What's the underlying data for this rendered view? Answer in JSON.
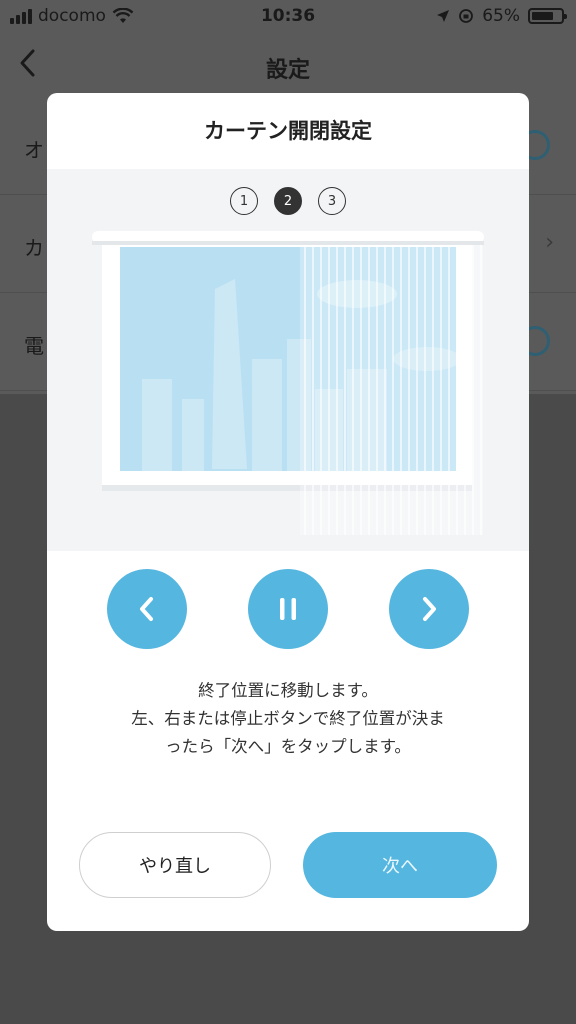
{
  "status_bar": {
    "carrier": "docomo",
    "time": "10:36",
    "battery": "65%",
    "battery_level": 0.65
  },
  "nav": {
    "title": "設定",
    "back_icon": "chevron-left-icon"
  },
  "background_rows": [
    {
      "label": "オ",
      "control": "toggle"
    },
    {
      "label": "カ",
      "control": "chevron"
    },
    {
      "label": "電",
      "control": "toggle"
    }
  ],
  "dialog": {
    "title": "カーテン開閉設定",
    "steps": [
      "1",
      "2",
      "3"
    ],
    "active_step": 2,
    "buttons": {
      "left": "chevron-left-icon",
      "pause": "pause-icon",
      "right": "chevron-right-icon"
    },
    "description": [
      "終了位置に移動します。",
      "左、右または停止ボタンで終了位置が決ま",
      "ったら「次へ」をタップします。"
    ],
    "retry_label": "やり直し",
    "next_label": "次へ"
  },
  "colors": {
    "accent": "#55b6e0",
    "overlay": "#4a4a4a",
    "dialog_bg": "#ffffff",
    "illustration_bg": "#f2f4f6"
  }
}
